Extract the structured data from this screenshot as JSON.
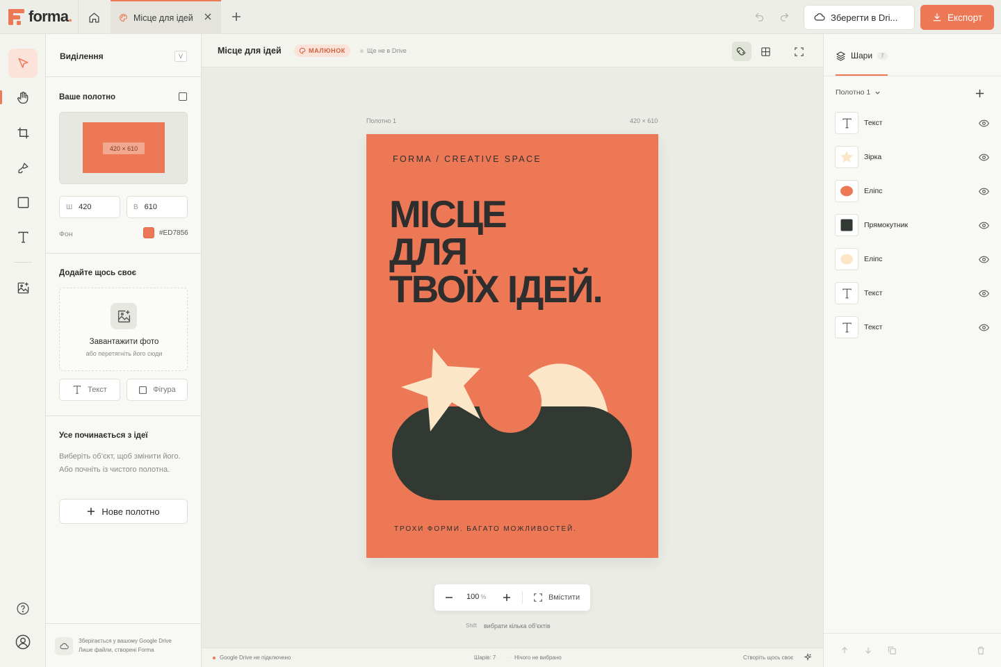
{
  "app": {
    "logo_text": "forma",
    "logo_dot": "."
  },
  "tabs": [
    {
      "label": "Місце для ідей",
      "icon": "palette-icon",
      "active": true
    }
  ],
  "topbar": {
    "save_drive_label": "Зберегти в Dri...",
    "export_label": "Експорт"
  },
  "tools": [
    {
      "name": "select",
      "icon": "cursor-icon",
      "active": true
    },
    {
      "name": "hand",
      "icon": "hand-icon"
    },
    {
      "name": "crop",
      "icon": "crop-icon"
    },
    {
      "name": "brush",
      "icon": "brush-icon"
    },
    {
      "name": "shape",
      "icon": "square-icon"
    },
    {
      "name": "text",
      "icon": "text-icon"
    },
    {
      "name": "image",
      "icon": "image-add-icon"
    }
  ],
  "left_panel": {
    "selection_title": "Виділення",
    "selection_shortcut": "V",
    "canvas_section_title": "Ваше полотно",
    "preview_label": "420 × 610",
    "width_label": "Ш",
    "width_value": "420",
    "height_label": "В",
    "height_value": "610",
    "background_label": "Фон",
    "background_hex": "#ED7856",
    "add_section_title": "Додайте щось своє",
    "upload_title": "Завантажити фото",
    "upload_sub": "або перетягніть його сюди",
    "text_button": "Текст",
    "shape_button": "Фігура",
    "empty_title": "Усе починається з ідеї",
    "empty_desc": "Виберіть об’єкт, щоб змінити його. Або почніть із чистого полотна.",
    "new_canvas_button": "Нове полотно",
    "drive_note_line1": "Зберігається у вашому Google Drive",
    "drive_note_line2": "Лише файли, створені Forma"
  },
  "doc_header": {
    "title": "Місце для ідей",
    "type_badge": "МАЛЮНОК",
    "status": "Ще не в Drive"
  },
  "artboard": {
    "name": "Полотно 1",
    "size": "420 × 610",
    "background": "#ED7856",
    "eyebrow": "FORMA / CREATIVE SPACE",
    "headline_line1": "МІСЦЕ",
    "headline_line2": "ДЛЯ",
    "headline_line3": "ТВОЇХ ІДЕЙ.",
    "footer": "ТРОХИ ФОРМИ. БАГАТО МОЖЛИВОСТЕЙ.",
    "colors": {
      "dark": "#323933",
      "cream": "#FBE7C8",
      "accent": "#ED7856"
    }
  },
  "zoom": {
    "value": "100",
    "unit": "%",
    "fit_label": "Вмістити"
  },
  "hint": {
    "key": "Shift",
    "text": "вибрати кілька об’єктів"
  },
  "status_bar": {
    "drive": "Google Drive не підключено",
    "layers": "Шарів: 7",
    "selection": "Нічого не вибрано",
    "create": "Створіть щось своє"
  },
  "layers_panel": {
    "tab_label": "Шари",
    "count": "7",
    "canvas_select": "Полотно 1",
    "layers": [
      {
        "name": "Текст",
        "type": "text"
      },
      {
        "name": "Зірка",
        "type": "star",
        "color": "#FBE7C8"
      },
      {
        "name": "Еліпс",
        "type": "ellipse",
        "color": "#ED7856"
      },
      {
        "name": "Прямокутник",
        "type": "rect",
        "color": "#323933"
      },
      {
        "name": "Еліпс",
        "type": "ellipse",
        "color": "#FBE7C8"
      },
      {
        "name": "Текст",
        "type": "text"
      },
      {
        "name": "Текст",
        "type": "text"
      }
    ]
  }
}
